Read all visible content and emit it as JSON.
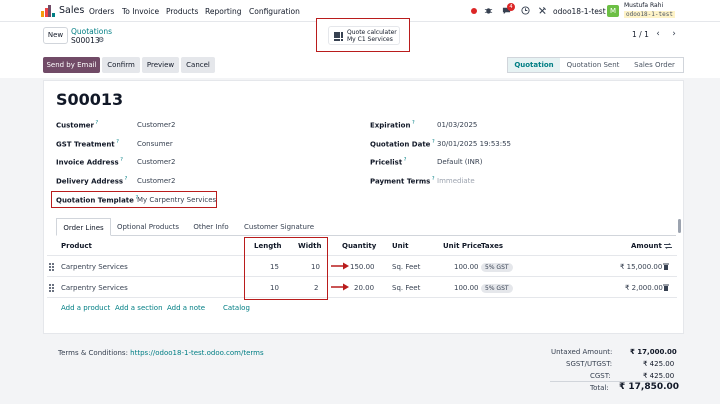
{
  "app": {
    "name": "Sales",
    "brand_color": "#714b67",
    "accent_color": "#017e84"
  },
  "nav": {
    "menus": [
      "Orders",
      "To Invoice",
      "Products",
      "Reporting",
      "Configuration"
    ],
    "chat_badge": "4",
    "db_name": "odoo18-1-test",
    "user_initial": "M",
    "user_name": "Mustufa Rahi",
    "user_db": "odoo18-1-test"
  },
  "control": {
    "new_label": "New",
    "breadcrumb_parent": "Quotations",
    "breadcrumb_current": "S00013",
    "quote_calc_line1": "Quote calculater",
    "quote_calc_line2": "My C1 Services",
    "pager": "1 / 1"
  },
  "actions": {
    "send_by_email": "Send by Email",
    "confirm": "Confirm",
    "preview": "Preview",
    "cancel": "Cancel"
  },
  "status": {
    "steps": [
      "Quotation",
      "Quotation Sent",
      "Sales Order"
    ],
    "active": "Quotation"
  },
  "form": {
    "order_name": "S00013",
    "customer_label": "Customer",
    "customer": "Customer2",
    "gst_label": "GST Treatment",
    "gst": "Consumer",
    "invoice_label": "Invoice Address",
    "invoice_address": "Customer2",
    "delivery_label": "Delivery Address",
    "delivery_address": "Customer2",
    "template_label": "Quotation Template",
    "template": "My Carpentry Services",
    "expiration_label": "Expiration",
    "expiration": "01/03/2025",
    "quotation_date_label": "Quotation Date",
    "quotation_date": "30/01/2025 19:53:55",
    "pricelist_label": "Pricelist",
    "pricelist": "Default (INR)",
    "payment_terms_label": "Payment Terms",
    "payment_terms": "Immediate"
  },
  "tabs": [
    "Order Lines",
    "Optional Products",
    "Other Info",
    "Customer Signature"
  ],
  "table": {
    "headers": {
      "product": "Product",
      "length": "Length",
      "width": "Width",
      "quantity": "Quantity",
      "unit": "Unit",
      "unit_price": "Unit Price",
      "taxes": "Taxes",
      "amount": "Amount"
    },
    "rows": [
      {
        "product": "Carpentry Services",
        "length": "15",
        "width": "10",
        "quantity": "150.00",
        "unit": "Sq. Feet",
        "unit_price": "100.00",
        "taxes": "5% GST",
        "amount": "₹ 15,000.00"
      },
      {
        "product": "Carpentry Services",
        "length": "10",
        "width": "2",
        "quantity": "20.00",
        "unit": "Sq. Feet",
        "unit_price": "100.00",
        "taxes": "5% GST",
        "amount": "₹ 2,000.00"
      }
    ],
    "add_links": [
      "Add a product",
      "Add a section",
      "Add a note",
      "Catalog"
    ]
  },
  "footer": {
    "terms_label": "Terms & Conditions:",
    "terms_link": "https://odoo18-1-test.odoo.com/terms",
    "untaxed_label": "Untaxed Amount:",
    "untaxed": "₹ 17,000.00",
    "sgst_label": "SGST/UTGST:",
    "sgst": "₹ 425.00",
    "cgst_label": "CGST:",
    "cgst": "₹ 425.00",
    "total_label": "Total:",
    "total": "₹ 17,850.00"
  }
}
